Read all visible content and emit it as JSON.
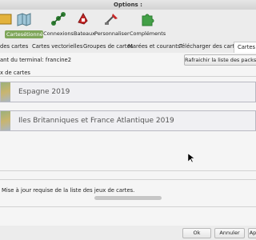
{
  "window": {
    "title": "Options :"
  },
  "toolbar": {
    "items": [
      {
        "label": "",
        "icon": "folder-icon"
      },
      {
        "label": "Cartesétionnées",
        "icon": "map-icon"
      },
      {
        "label": "Connexions",
        "icon": "connections-icon"
      },
      {
        "label": "Bateaux",
        "icon": "boat-icon"
      },
      {
        "label": "Personnaliser",
        "icon": "customize-icon"
      },
      {
        "label": "Compléments",
        "icon": "puzzle-icon"
      }
    ]
  },
  "tabs": [
    "des cartes",
    "Cartes vectorielles",
    "Groupes de cartes",
    "Marées et courants",
    "Télécharger des cartes",
    "Cartes d"
  ],
  "terminal_label": "ant du terminal: francine2",
  "refresh_button": "Rafraichir la liste des packs de",
  "section_label": "x de cartes",
  "chart_packs": [
    {
      "name": "Espagne 2019"
    },
    {
      "name": "Iles Britanniques et France Atlantique 2019"
    }
  ],
  "status": {
    "text": "Mise à jour requise de la liste des jeux de cartes."
  },
  "dialog": {
    "ok": "Ok",
    "cancel": "Annuler",
    "apply": "Ap"
  }
}
